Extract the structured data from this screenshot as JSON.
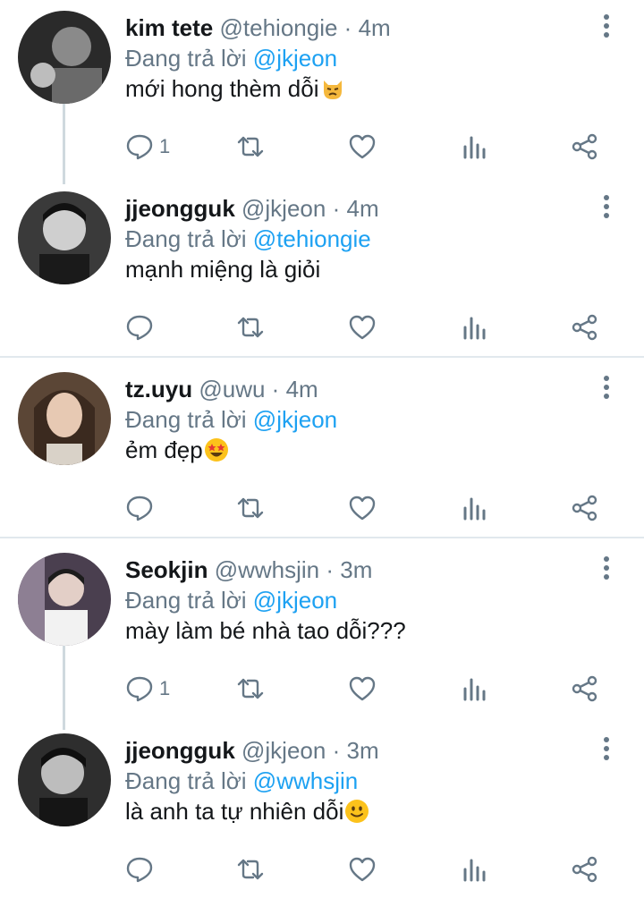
{
  "labels": {
    "replying_to": "Đang trả lời"
  },
  "colors": {
    "text": "#14171a",
    "muted": "#657786",
    "mention": "#1da1f2",
    "divider": "#e1e8ed",
    "thread_line": "#cfd9de"
  },
  "tweets": [
    {
      "name": "kim tete",
      "handle": "@tehiongie",
      "time": "4m",
      "reply_to": "@jkjeon",
      "text": "mới hong thèm dỗi",
      "emoji": "pouting-cat-emoji",
      "reply_count": "1"
    },
    {
      "name": "jjeongguk",
      "handle": "@jkjeon",
      "time": "4m",
      "reply_to": "@tehiongie",
      "text": "mạnh miệng là giỏi",
      "emoji": "",
      "reply_count": ""
    },
    {
      "name": "tz.uyu",
      "handle": "@uwu",
      "time": "4m",
      "reply_to": "@jkjeon",
      "text": "ẻm đẹp",
      "emoji": "star-struck-emoji",
      "reply_count": ""
    },
    {
      "name": "Seokjin",
      "handle": "@wwhsjin",
      "time": "3m",
      "reply_to": "@jkjeon",
      "text": "mày làm bé nhà tao dỗi???",
      "emoji": "",
      "reply_count": "1"
    },
    {
      "name": "jjeongguk",
      "handle": "@jkjeon",
      "time": "3m",
      "reply_to": "@wwhsjin",
      "text": "là anh ta tự nhiên dỗi",
      "emoji": "slightly-smiling-emoji",
      "reply_count": ""
    }
  ]
}
